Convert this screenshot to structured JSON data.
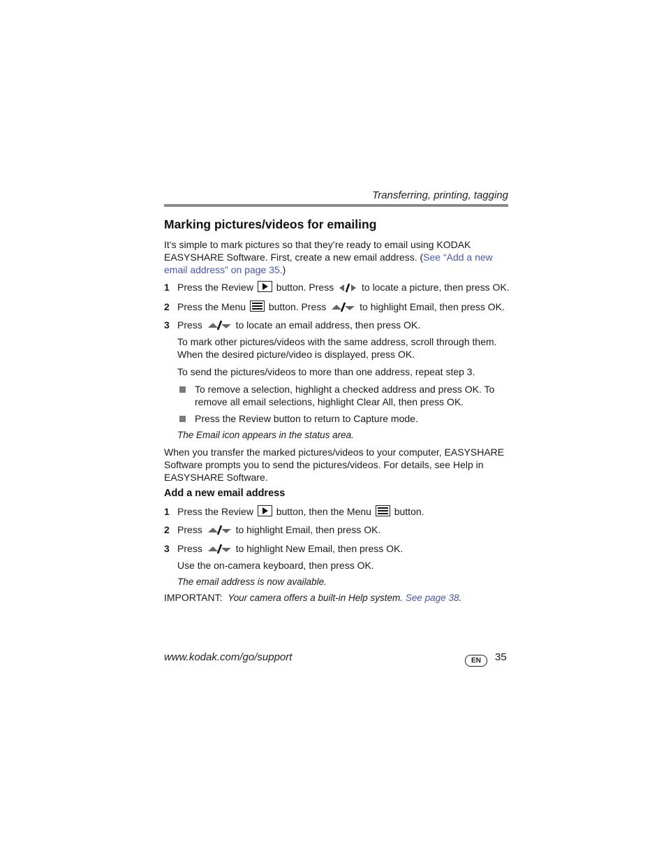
{
  "header": {
    "section_title": "Transferring, printing, tagging"
  },
  "title": "Marking pictures/videos for emailing",
  "intro": {
    "text": "It’s simple to mark pictures so that they’re ready to email using KODAK EASYSHARE Software. First, create a new email address. (",
    "link": "See “Add a new email address” on page 35.",
    "close": ")"
  },
  "steps": [
    {
      "num": "1",
      "a": "Press the Review",
      "b": "button. Press",
      "c": "to locate a picture, then press OK."
    },
    {
      "num": "2",
      "a": "Press the Menu",
      "b": "button. Press",
      "c": "to highlight Email, then press OK."
    },
    {
      "num": "3",
      "a": "Press",
      "c": "to locate an email address, then press OK."
    }
  ],
  "step3_notes": [
    "To mark other pictures/videos with the same address, scroll through them. When the desired picture/video is displayed, press OK.",
    "To send the pictures/videos to more than one address, repeat step 3."
  ],
  "bullets": [
    "To remove a selection, highlight a checked address and press OK. To remove all email selections, highlight Clear All, then press OK.",
    "Press the Review button to return to Capture mode."
  ],
  "result_note": "The Email icon appears in the status area.",
  "transfer_para": "When you transfer the marked pictures/videos to your computer, EASYSHARE Software prompts you to send the pictures/videos. For details, see Help in EASYSHARE Software.",
  "subheading": "Add a new email address",
  "sub_steps": [
    {
      "num": "1",
      "a": "Press the Review",
      "b": "button, then the Menu",
      "c": "button."
    },
    {
      "num": "2",
      "a": "Press",
      "c": "to highlight Email, then press OK."
    },
    {
      "num": "3",
      "a": "Press",
      "c": "to highlight New Email, then press OK."
    }
  ],
  "sub_note": "Use the on-camera keyboard, then press OK.",
  "sub_result": "The email address is now available.",
  "important": {
    "label": "IMPORTANT:",
    "text": "Your camera offers a built-in Help system.",
    "link": "See page 38",
    "end": "."
  },
  "footer": {
    "url": "www.kodak.com/go/support",
    "lang_badge": "EN",
    "page_number": "35"
  },
  "colors": {
    "link": "#4b57a8",
    "rule": "#8a8a8a",
    "bullet": "#7a7a7a"
  }
}
